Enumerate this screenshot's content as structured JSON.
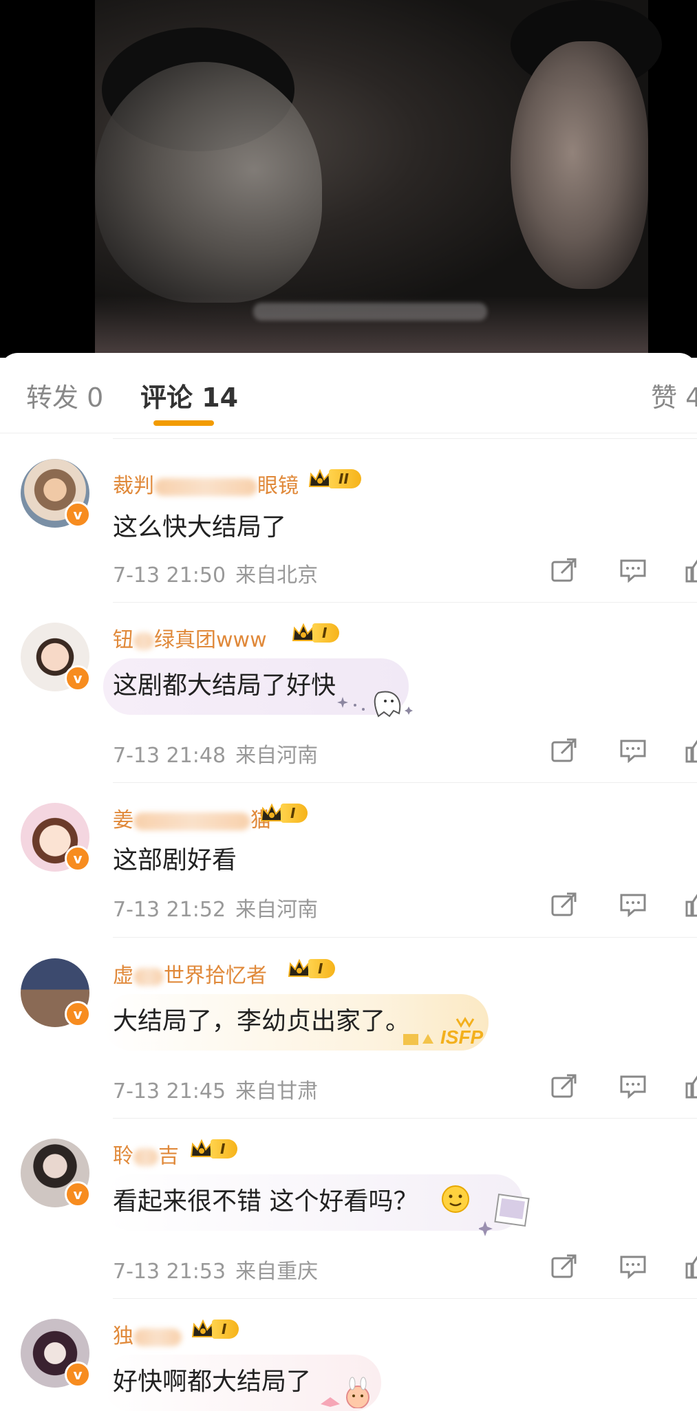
{
  "tabs": {
    "repost": "转发 0",
    "comments": "评论 14",
    "likes": "赞 4"
  },
  "colors": {
    "accent": "#f29b00",
    "username": "#e0893a",
    "vbadge": "#f78c1f"
  },
  "comments": [
    {
      "name_visible": "裁判",
      "name_suffix": "眼镜",
      "level": "II",
      "text": "这么快大结局了",
      "time": "7-13 21:50",
      "source": "来自北京"
    },
    {
      "name_visible": "钮",
      "name_suffix": "绿真团www",
      "level": "I",
      "text": "这剧都大结局了好快",
      "time": "7-13 21:48",
      "source": "来自河南"
    },
    {
      "name_visible": "姜",
      "name_suffix": "猫",
      "level": "I",
      "text": "这部剧好看",
      "time": "7-13 21:52",
      "source": "来自河南"
    },
    {
      "name_visible": "虚",
      "name_suffix": "世界拾忆者",
      "level": "I",
      "text": "大结局了，李幼贞出家了。",
      "time": "7-13 21:45",
      "source": "来自甘肃"
    },
    {
      "name_visible": "聆",
      "name_suffix": "吉",
      "level": "I",
      "text": "看起来很不错 这个好看吗？",
      "time": "7-13 21:53",
      "source": "来自重庆"
    },
    {
      "name_visible": "独",
      "name_suffix": "",
      "level": "I",
      "text": "好快啊都大结局了",
      "time": "",
      "source": ""
    }
  ],
  "icons": [
    "share-icon",
    "reply-icon",
    "like-icon",
    "vip-crown-icon",
    "verified-v-icon"
  ]
}
